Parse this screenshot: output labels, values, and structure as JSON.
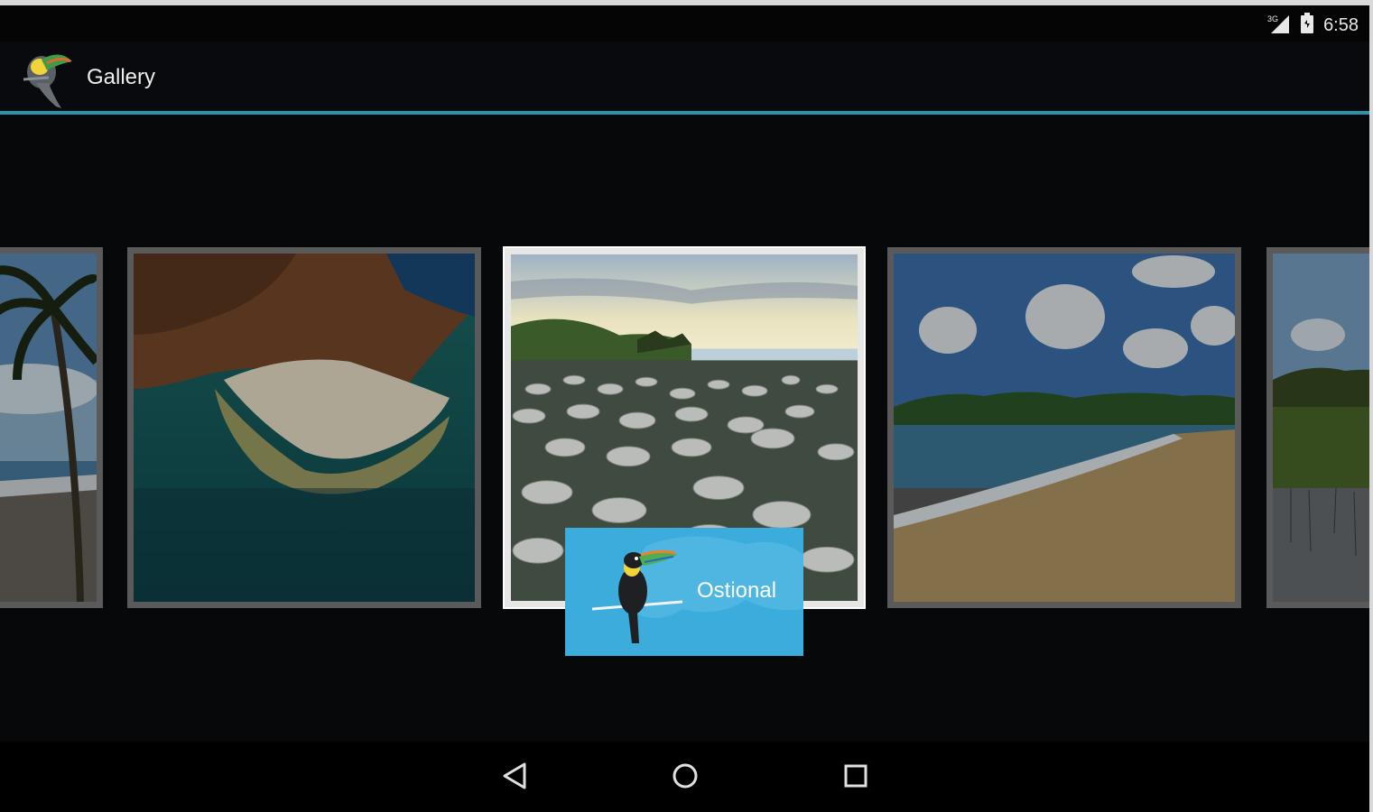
{
  "status_bar": {
    "time": "6:58",
    "network_label": "3G"
  },
  "action_bar": {
    "title": "Gallery"
  },
  "gallery": {
    "selected_index": 2,
    "items": [
      {
        "name": "palm-beach"
      },
      {
        "name": "aerial-cove"
      },
      {
        "name": "turtle-beach"
      },
      {
        "name": "bay-beach"
      },
      {
        "name": "wetland"
      }
    ],
    "caption": "Ostional"
  },
  "nav_bar": {
    "buttons": [
      "back-icon",
      "home-icon",
      "recents-icon"
    ]
  },
  "colors": {
    "accent": "#2c93ad",
    "caption_bg": "#3bacdb",
    "background": "#07080a"
  }
}
